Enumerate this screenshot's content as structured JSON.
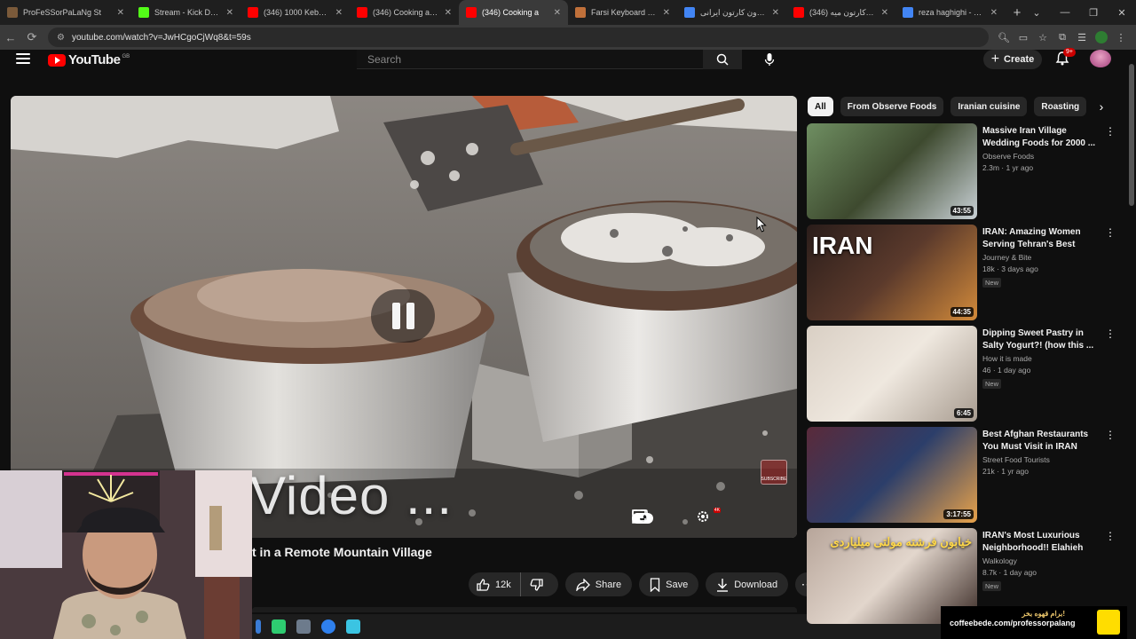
{
  "browser": {
    "tabs": [
      {
        "title": "ProFeSSorPaLaNg St",
        "favicon": "#7b5a3a",
        "active": false
      },
      {
        "title": "Stream - Kick Dashbo",
        "favicon": "#53fc18",
        "active": false
      },
      {
        "title": "(346) 1000 Kebabs a",
        "favicon": "#ff0000",
        "active": false
      },
      {
        "title": "(346) Cooking a Mas",
        "favicon": "#ff0000",
        "active": false
      },
      {
        "title": "(346) Cooking a",
        "favicon": "#ff0000",
        "active": true
      },
      {
        "title": "Farsi Keyboard - کلید",
        "favicon": "#c0703a",
        "active": false
      },
      {
        "title": "هلندون کارتون ایرانی",
        "favicon": "#4285f4",
        "active": false
      },
      {
        "title": "تیتراژ کارتون میه (346)",
        "favicon": "#ff0000",
        "active": false
      },
      {
        "title": "reza haghighi - Goo",
        "favicon": "#4285f4",
        "active": false
      }
    ],
    "url": "youtube.com/watch?v=JwHCgoCjWq8&t=59s"
  },
  "header": {
    "logo_text": "YouTube",
    "logo_suffix": "GB",
    "search_placeholder": "Search",
    "create_label": "Create",
    "notif_count": "9+"
  },
  "player": {
    "overlay_text": "Video ...",
    "subscribe_watermark": "SUBSCRIBE",
    "hd_badge": "4K"
  },
  "video": {
    "title": "t in a Remote Mountain Village",
    "likes": "12k",
    "share_label": "Share",
    "save_label": "Save",
    "download_label": "Download"
  },
  "chips": [
    "All",
    "From Observe Foods",
    "Iranian cuisine",
    "Roasting"
  ],
  "recommendations": [
    {
      "title": "Massive Iran Village Wedding Foods for 2000 ...",
      "channel": "Observe Foods",
      "stats": "2.3m · 1 yr ago",
      "duration": "43:55",
      "badge": "",
      "palette": [
        "#6f8f62",
        "#c9d1d6",
        "#3e4a2f"
      ]
    },
    {
      "title": "IRAN: Amazing Women Serving Tehran's Best Stree...",
      "channel": "Journey & Bite",
      "stats": "18k · 3 days ago",
      "duration": "44:35",
      "badge": "New",
      "palette": [
        "#2a1d1a",
        "#d28a3a",
        "#5b3a2c"
      ],
      "thumb_text": "IRAN"
    },
    {
      "title": "Dipping Sweet Pastry in Salty Yogurt?! (how this ...",
      "channel": "How it is made",
      "stats": "46 · 1 day ago",
      "duration": "6:45",
      "badge": "New",
      "palette": [
        "#d9cfc4",
        "#a89c90",
        "#efe8df"
      ]
    },
    {
      "title": "Best Afghan Restaurants You Must Visit in IRAN",
      "channel": "Street Food Tourists",
      "stats": "21k · 1 yr ago",
      "duration": "3:17:55",
      "badge": "",
      "palette": [
        "#5a2a3a",
        "#e8a24a",
        "#2c3e6a"
      ]
    },
    {
      "title": "IRAN's Most Luxurious Neighborhood!! Elahieh الهیه",
      "channel": "Walkology",
      "stats": "8.7k · 1 day ago",
      "duration": "",
      "badge": "New",
      "palette": [
        "#b7a59a",
        "#3a2a25",
        "#e2d6cc"
      ],
      "thumb_text": "خیابون فرشته  مولتی میلیاردی"
    }
  ],
  "promo": {
    "text": "coffeebede.com/professorpalang",
    "fa_text": "برام قهوه بخر!"
  }
}
